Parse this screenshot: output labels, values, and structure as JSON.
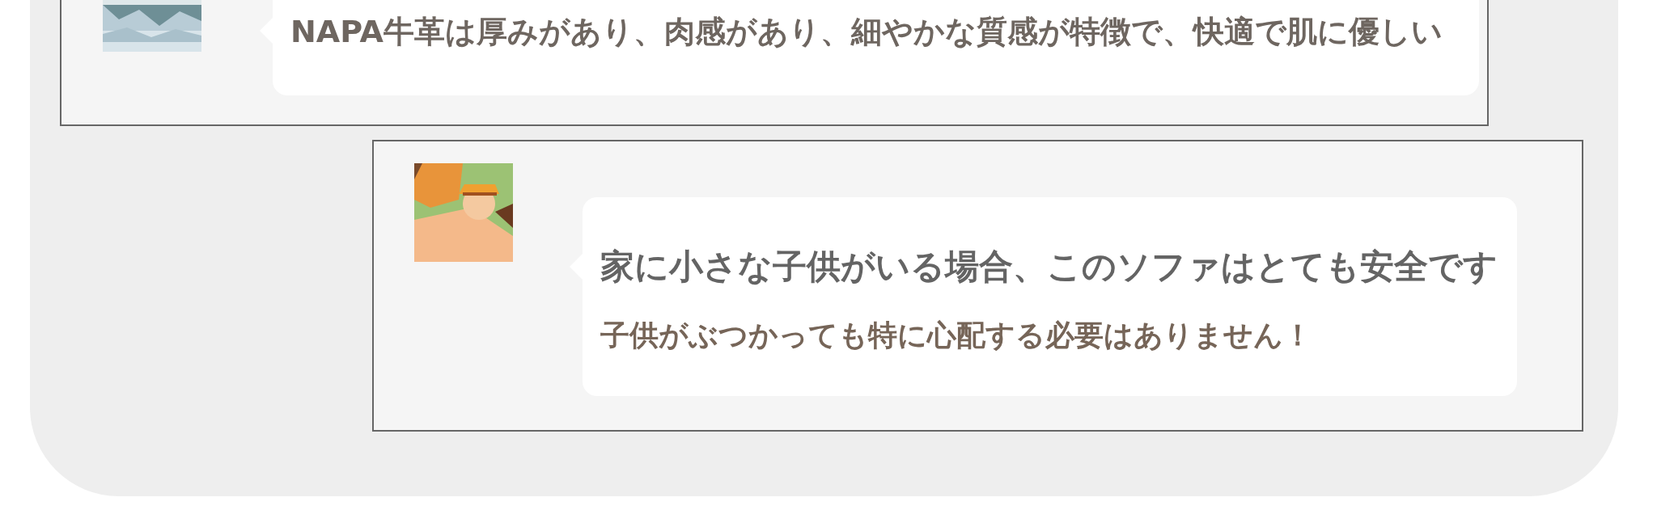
{
  "messages": [
    {
      "avatar": {
        "kind": "picture"
      },
      "lines": [
        {
          "kind": "body",
          "text": "NAPA牛革は厚みがあり、肉感があり、細やかな質感が特徴で、快適で肌に優しい"
        }
      ]
    },
    {
      "avatar": {
        "kind": "picture"
      },
      "lines": [
        {
          "kind": "title",
          "text": "家に小さな子供がいる場合、このソファはとても安全です"
        },
        {
          "kind": "note",
          "text": "子供がぶつかっても特に心配する必要はありません！"
        }
      ]
    }
  ]
}
